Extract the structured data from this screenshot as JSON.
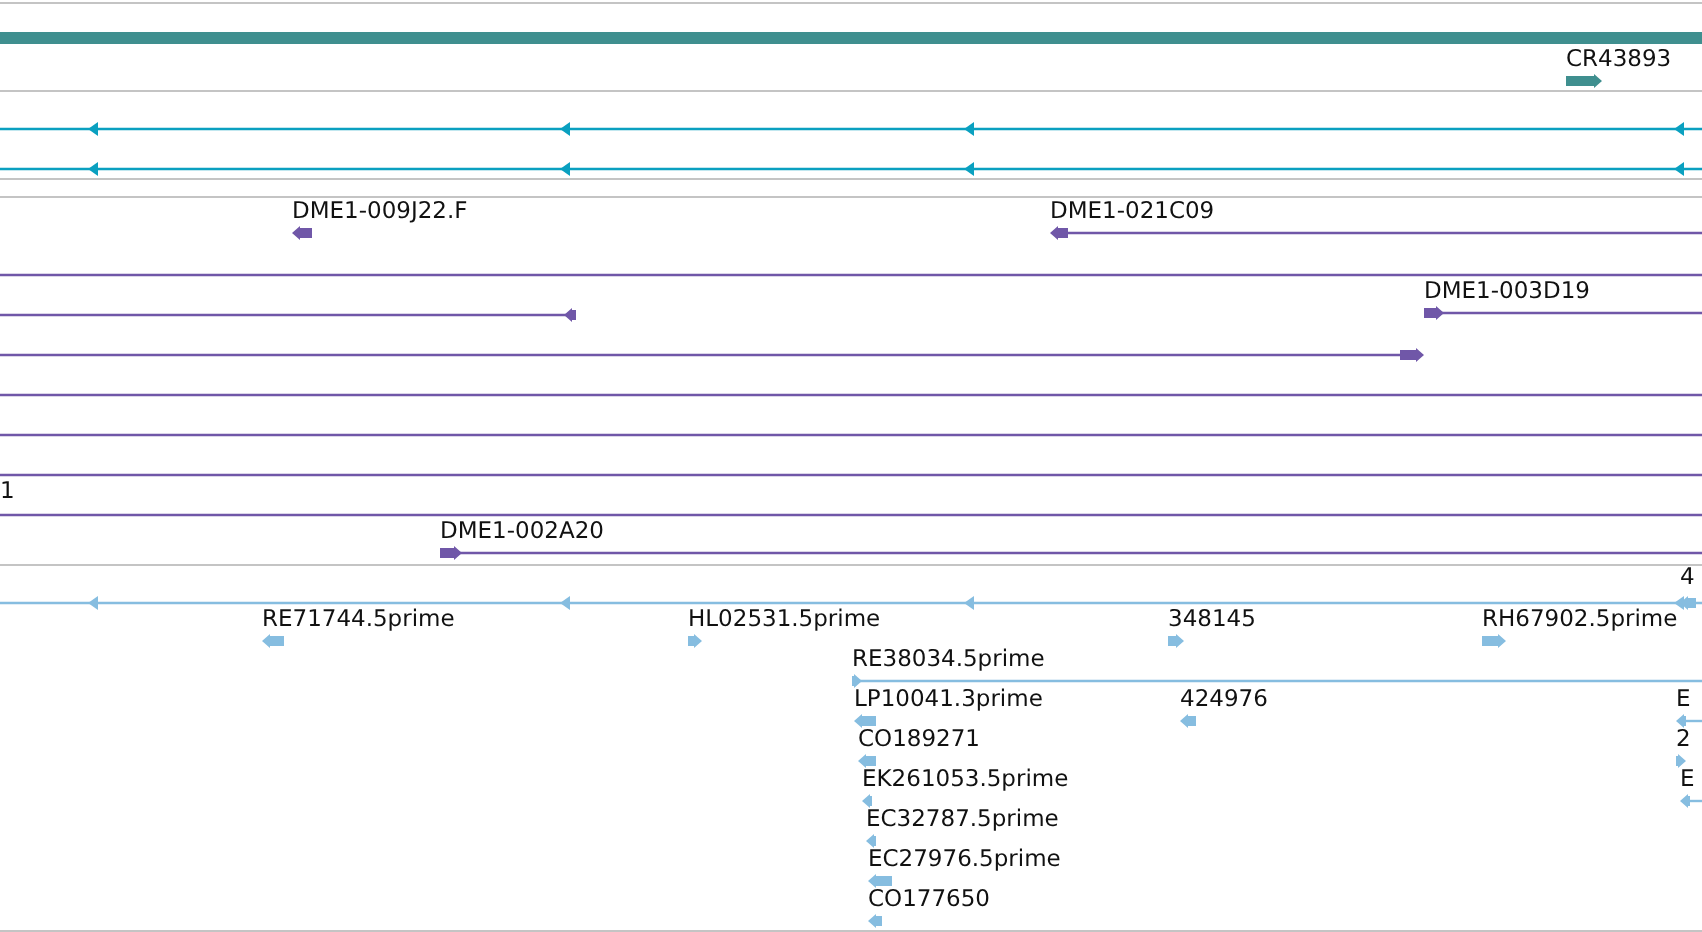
{
  "tracks": [
    {
      "kind": "gene",
      "features": [
        {
          "label": "CR43893",
          "forward": true
        }
      ]
    },
    {
      "kind": "clone",
      "features": [
        {
          "label": "DME1-009J22.F",
          "forward": false
        },
        {
          "label": "DME1-021C09",
          "forward": false
        },
        {
          "forward": false
        },
        {
          "label": "DME1-003D19",
          "forward": true
        },
        {
          "forward": true
        },
        {
          "label": "1"
        },
        {
          "label": "DME1-002A20",
          "forward": true
        }
      ]
    },
    {
      "kind": "est",
      "features": [
        {
          "label": "4",
          "forward": false
        },
        {
          "label": "RE71744.5prime",
          "forward": false
        },
        {
          "label": "HL02531.5prime",
          "forward": true
        },
        {
          "label": "348145",
          "forward": true
        },
        {
          "label": "RH67902.5prime",
          "forward": true
        },
        {
          "label": "RE38034.5prime",
          "forward": true
        },
        {
          "label": "LP10041.3prime",
          "forward": false
        },
        {
          "label": "424976",
          "forward": false
        },
        {
          "label": "E",
          "forward": false
        },
        {
          "label": "CO189271",
          "forward": false
        },
        {
          "label": "2",
          "forward": true
        },
        {
          "label": "EK261053.5prime",
          "forward": false
        },
        {
          "label": "E",
          "forward": false
        },
        {
          "label": "EC32787.5prime",
          "forward": false
        },
        {
          "label": "EC27976.5prime",
          "forward": false
        },
        {
          "label": "CO177650",
          "forward": false
        }
      ]
    }
  ]
}
